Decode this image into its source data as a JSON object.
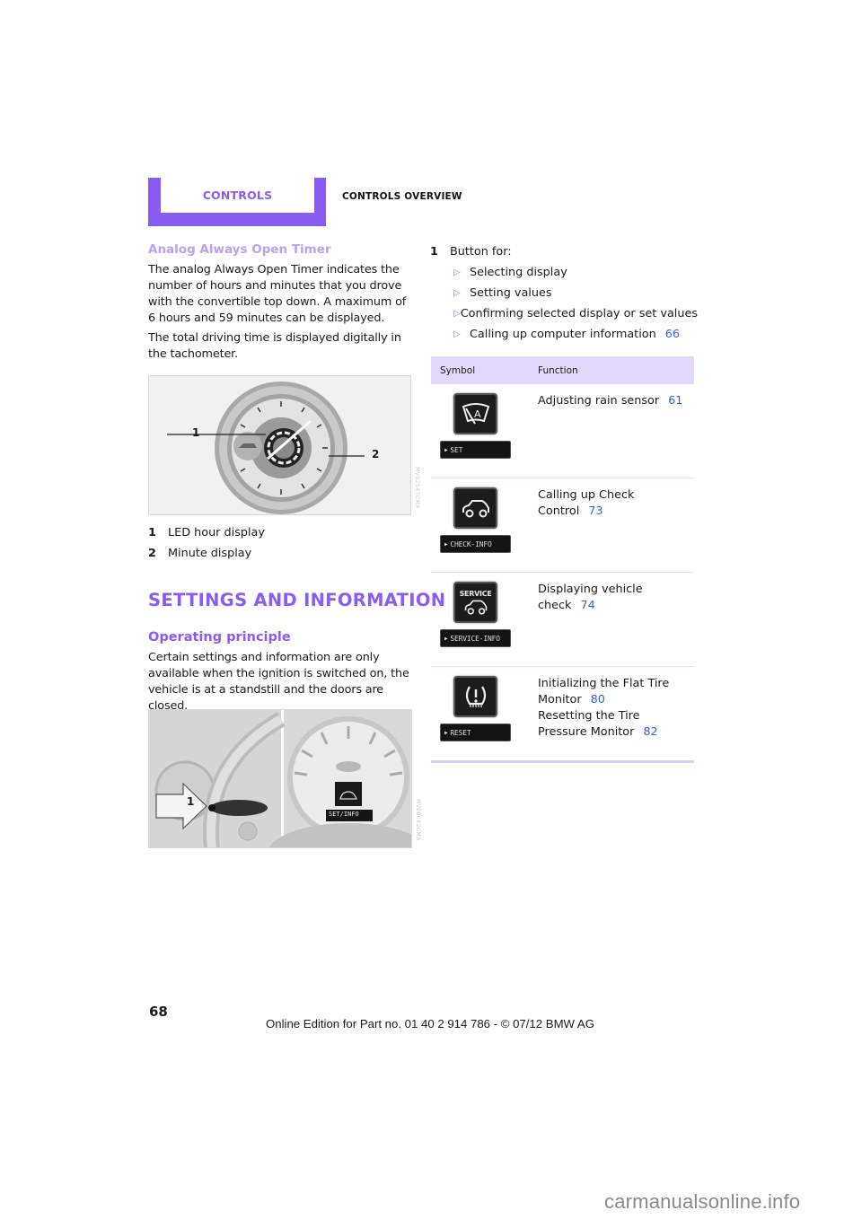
{
  "header": {
    "chapter_tab": "CONTROLS",
    "section_title": "CONTROLS OVERVIEW"
  },
  "timer_section": {
    "heading": "Analog Always Open Timer",
    "paragraph1": "The analog Always Open Timer indicates the number of hours and minutes that you drove with the convertible top down. A maximum of 6 hours and 59 minutes can be displayed.",
    "paragraph2": "The total driving time is displayed digitally in the tachometer.",
    "figure": {
      "callout1": "1",
      "callout2": "2",
      "code": "MV02547CMA"
    },
    "legend": [
      {
        "num": "1",
        "text": "LED hour display"
      },
      {
        "num": "2",
        "text": "Minute display"
      }
    ]
  },
  "settings_section": {
    "heading": "SETTINGS AND INFORMATION",
    "subheading": "Operating principle",
    "paragraph": "Certain settings and information are only available when the ignition is switched on, the vehicle is at a standstill and the doors are closed.",
    "figure": {
      "callout": "1",
      "display_label": "SET/INFO",
      "code": "MV00082CMA"
    }
  },
  "button_list": {
    "num": "1",
    "intro": "Button for:",
    "items": [
      {
        "text": "Selecting display",
        "ref": ""
      },
      {
        "text": "Setting values",
        "ref": ""
      },
      {
        "text": "Confirming selected display or set values",
        "ref": ""
      },
      {
        "text": "Calling up computer information",
        "ref": "66"
      }
    ]
  },
  "table": {
    "headers": {
      "symbol": "Symbol",
      "function": "Function"
    },
    "rows": [
      {
        "icon": "rain-sensor-icon",
        "label": "SET",
        "lines": [
          {
            "text": "Adjusting rain sensor",
            "ref": "61"
          }
        ]
      },
      {
        "icon": "car-icon",
        "label": "CHECK-INFO",
        "lines": [
          {
            "text": "Calling up Check",
            "ref": ""
          },
          {
            "text": "Control",
            "ref": "73"
          }
        ]
      },
      {
        "icon": "service-car-icon",
        "icon_text": "SERVICE",
        "label": "SERVICE-INFO",
        "lines": [
          {
            "text": "Displaying vehicle",
            "ref": ""
          },
          {
            "text": "check",
            "ref": "74"
          }
        ]
      },
      {
        "icon": "tire-pressure-warning-icon",
        "label": "RESET",
        "lines": [
          {
            "text": "Initializing the Flat Tire",
            "ref": ""
          },
          {
            "text": "Monitor",
            "ref": "80"
          },
          {
            "text": "Resetting the Tire",
            "ref": ""
          },
          {
            "text": "Pressure Monitor",
            "ref": "82"
          }
        ]
      }
    ]
  },
  "footer": {
    "page_number": "68",
    "edition_text": "Online Edition for Part no. 01 40 2 914 786 - © 07/12 BMW AG",
    "watermark": "carmanualsonline.info"
  },
  "colors": {
    "accent": "#8a5cf6",
    "light_accent": "#b9a2f5",
    "table_header_bg": "#e2d8fb",
    "reference_link": "#2f64e8"
  }
}
